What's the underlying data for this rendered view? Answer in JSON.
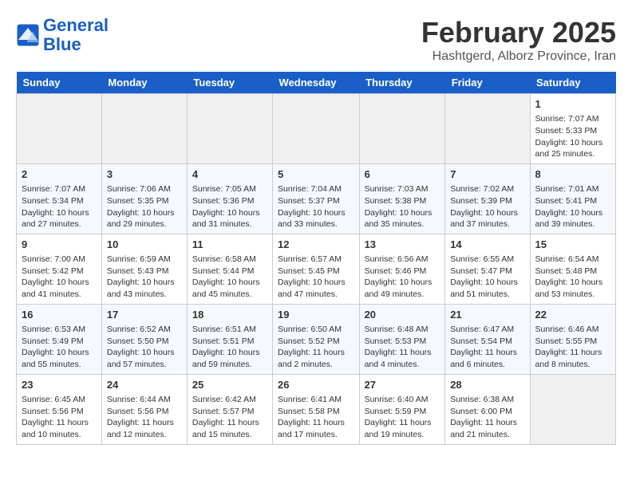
{
  "header": {
    "logo_line1": "General",
    "logo_line2": "Blue",
    "month": "February 2025",
    "location": "Hashtgerd, Alborz Province, Iran"
  },
  "weekdays": [
    "Sunday",
    "Monday",
    "Tuesday",
    "Wednesday",
    "Thursday",
    "Friday",
    "Saturday"
  ],
  "weeks": [
    [
      {
        "day": "",
        "info": ""
      },
      {
        "day": "",
        "info": ""
      },
      {
        "day": "",
        "info": ""
      },
      {
        "day": "",
        "info": ""
      },
      {
        "day": "",
        "info": ""
      },
      {
        "day": "",
        "info": ""
      },
      {
        "day": "1",
        "info": "Sunrise: 7:07 AM\nSunset: 5:33 PM\nDaylight: 10 hours and 25 minutes."
      }
    ],
    [
      {
        "day": "2",
        "info": "Sunrise: 7:07 AM\nSunset: 5:34 PM\nDaylight: 10 hours and 27 minutes."
      },
      {
        "day": "3",
        "info": "Sunrise: 7:06 AM\nSunset: 5:35 PM\nDaylight: 10 hours and 29 minutes."
      },
      {
        "day": "4",
        "info": "Sunrise: 7:05 AM\nSunset: 5:36 PM\nDaylight: 10 hours and 31 minutes."
      },
      {
        "day": "5",
        "info": "Sunrise: 7:04 AM\nSunset: 5:37 PM\nDaylight: 10 hours and 33 minutes."
      },
      {
        "day": "6",
        "info": "Sunrise: 7:03 AM\nSunset: 5:38 PM\nDaylight: 10 hours and 35 minutes."
      },
      {
        "day": "7",
        "info": "Sunrise: 7:02 AM\nSunset: 5:39 PM\nDaylight: 10 hours and 37 minutes."
      },
      {
        "day": "8",
        "info": "Sunrise: 7:01 AM\nSunset: 5:41 PM\nDaylight: 10 hours and 39 minutes."
      }
    ],
    [
      {
        "day": "9",
        "info": "Sunrise: 7:00 AM\nSunset: 5:42 PM\nDaylight: 10 hours and 41 minutes."
      },
      {
        "day": "10",
        "info": "Sunrise: 6:59 AM\nSunset: 5:43 PM\nDaylight: 10 hours and 43 minutes."
      },
      {
        "day": "11",
        "info": "Sunrise: 6:58 AM\nSunset: 5:44 PM\nDaylight: 10 hours and 45 minutes."
      },
      {
        "day": "12",
        "info": "Sunrise: 6:57 AM\nSunset: 5:45 PM\nDaylight: 10 hours and 47 minutes."
      },
      {
        "day": "13",
        "info": "Sunrise: 6:56 AM\nSunset: 5:46 PM\nDaylight: 10 hours and 49 minutes."
      },
      {
        "day": "14",
        "info": "Sunrise: 6:55 AM\nSunset: 5:47 PM\nDaylight: 10 hours and 51 minutes."
      },
      {
        "day": "15",
        "info": "Sunrise: 6:54 AM\nSunset: 5:48 PM\nDaylight: 10 hours and 53 minutes."
      }
    ],
    [
      {
        "day": "16",
        "info": "Sunrise: 6:53 AM\nSunset: 5:49 PM\nDaylight: 10 hours and 55 minutes."
      },
      {
        "day": "17",
        "info": "Sunrise: 6:52 AM\nSunset: 5:50 PM\nDaylight: 10 hours and 57 minutes."
      },
      {
        "day": "18",
        "info": "Sunrise: 6:51 AM\nSunset: 5:51 PM\nDaylight: 10 hours and 59 minutes."
      },
      {
        "day": "19",
        "info": "Sunrise: 6:50 AM\nSunset: 5:52 PM\nDaylight: 11 hours and 2 minutes."
      },
      {
        "day": "20",
        "info": "Sunrise: 6:48 AM\nSunset: 5:53 PM\nDaylight: 11 hours and 4 minutes."
      },
      {
        "day": "21",
        "info": "Sunrise: 6:47 AM\nSunset: 5:54 PM\nDaylight: 11 hours and 6 minutes."
      },
      {
        "day": "22",
        "info": "Sunrise: 6:46 AM\nSunset: 5:55 PM\nDaylight: 11 hours and 8 minutes."
      }
    ],
    [
      {
        "day": "23",
        "info": "Sunrise: 6:45 AM\nSunset: 5:56 PM\nDaylight: 11 hours and 10 minutes."
      },
      {
        "day": "24",
        "info": "Sunrise: 6:44 AM\nSunset: 5:56 PM\nDaylight: 11 hours and 12 minutes."
      },
      {
        "day": "25",
        "info": "Sunrise: 6:42 AM\nSunset: 5:57 PM\nDaylight: 11 hours and 15 minutes."
      },
      {
        "day": "26",
        "info": "Sunrise: 6:41 AM\nSunset: 5:58 PM\nDaylight: 11 hours and 17 minutes."
      },
      {
        "day": "27",
        "info": "Sunrise: 6:40 AM\nSunset: 5:59 PM\nDaylight: 11 hours and 19 minutes."
      },
      {
        "day": "28",
        "info": "Sunrise: 6:38 AM\nSunset: 6:00 PM\nDaylight: 11 hours and 21 minutes."
      },
      {
        "day": "",
        "info": ""
      }
    ]
  ]
}
